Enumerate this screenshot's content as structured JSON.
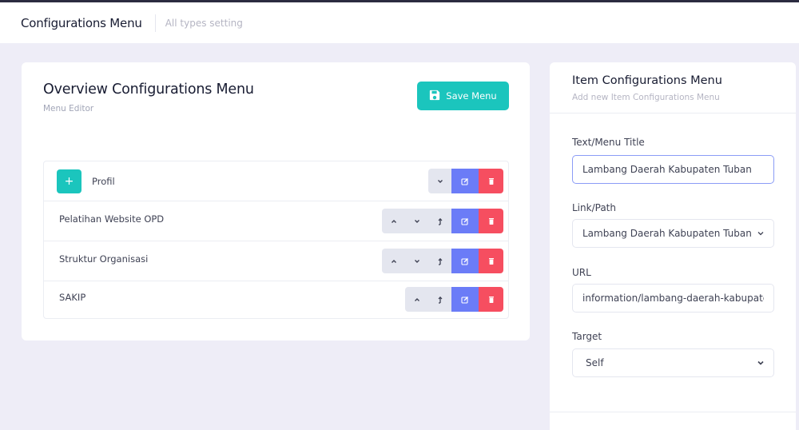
{
  "header": {
    "title": "Configurations Menu",
    "subtitle": "All types setting"
  },
  "overview": {
    "title": "Overview Configurations Menu",
    "subtitle": "Menu Editor",
    "save_label": "Save Menu",
    "expand_symbol": "+",
    "items": [
      {
        "label": "Profil",
        "actions": [
          "move-down",
          "edit",
          "delete"
        ]
      },
      {
        "label": "Pelatihan Website OPD",
        "actions": [
          "move-up",
          "move-down",
          "outdent",
          "edit",
          "delete"
        ]
      },
      {
        "label": "Struktur Organisasi",
        "actions": [
          "move-up",
          "move-down",
          "outdent",
          "edit",
          "delete"
        ]
      },
      {
        "label": "SAKIP",
        "actions": [
          "move-up",
          "outdent",
          "edit",
          "delete"
        ]
      }
    ]
  },
  "item_config": {
    "title": "Item Configurations Menu",
    "subtitle": "Add new Item Configurations Menu",
    "fields": {
      "text": {
        "label": "Text/Menu Title",
        "value": "Lambang Daerah Kabupaten Tuban"
      },
      "link": {
        "label": "Link/Path",
        "value": "Lambang Daerah Kabupaten Tuban"
      },
      "url": {
        "label": "URL",
        "value": "information/lambang-daerah-kabupaten-tuban"
      },
      "target": {
        "label": "Target",
        "value": "Self"
      }
    }
  },
  "colors": {
    "accent_teal": "#1bc5bd",
    "edit_blue": "#6b7cf7",
    "delete_red": "#f64e60",
    "page_bg": "#eeedf7"
  }
}
